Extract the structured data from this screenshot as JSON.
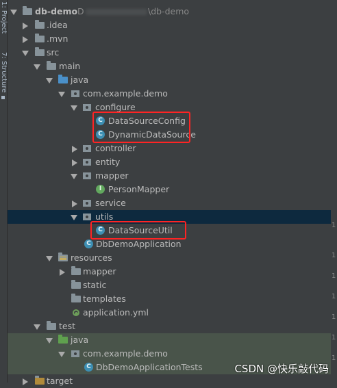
{
  "sidebar": {
    "tab1": "1: Project",
    "tab2": "7: Structure"
  },
  "project": {
    "name": "db-demo",
    "path_prefix": "D",
    "path_suffix": "\\db-demo"
  },
  "tree": {
    "idea": ".idea",
    "mvn": ".mvn",
    "src": "src",
    "main": "main",
    "java": "java",
    "pkg": "com.example.demo",
    "configure": "configure",
    "ds_config": "DataSourceConfig",
    "dyn_ds": "DynamicDataSource",
    "controller": "controller",
    "entity": "entity",
    "mapper": "mapper",
    "person_mapper": "PersonMapper",
    "service": "service",
    "utils": "utils",
    "ds_util": "DataSourceUtil",
    "app": "DbDemoApplication",
    "resources": "resources",
    "res_mapper": "mapper",
    "static": "static",
    "templates": "templates",
    "app_yml": "application.yml",
    "test": "test",
    "test_java": "java",
    "test_pkg": "com.example.demo",
    "app_tests": "DbDemoApplicationTests",
    "target": "target"
  },
  "icons": {
    "class": "C",
    "interface": "I"
  },
  "watermark": "CSDN @快乐敲代码",
  "colors": {
    "background": "#3c3f41",
    "selection": "#0d293e",
    "highlight_box": "#ff2424",
    "test_band": "#49544a"
  }
}
